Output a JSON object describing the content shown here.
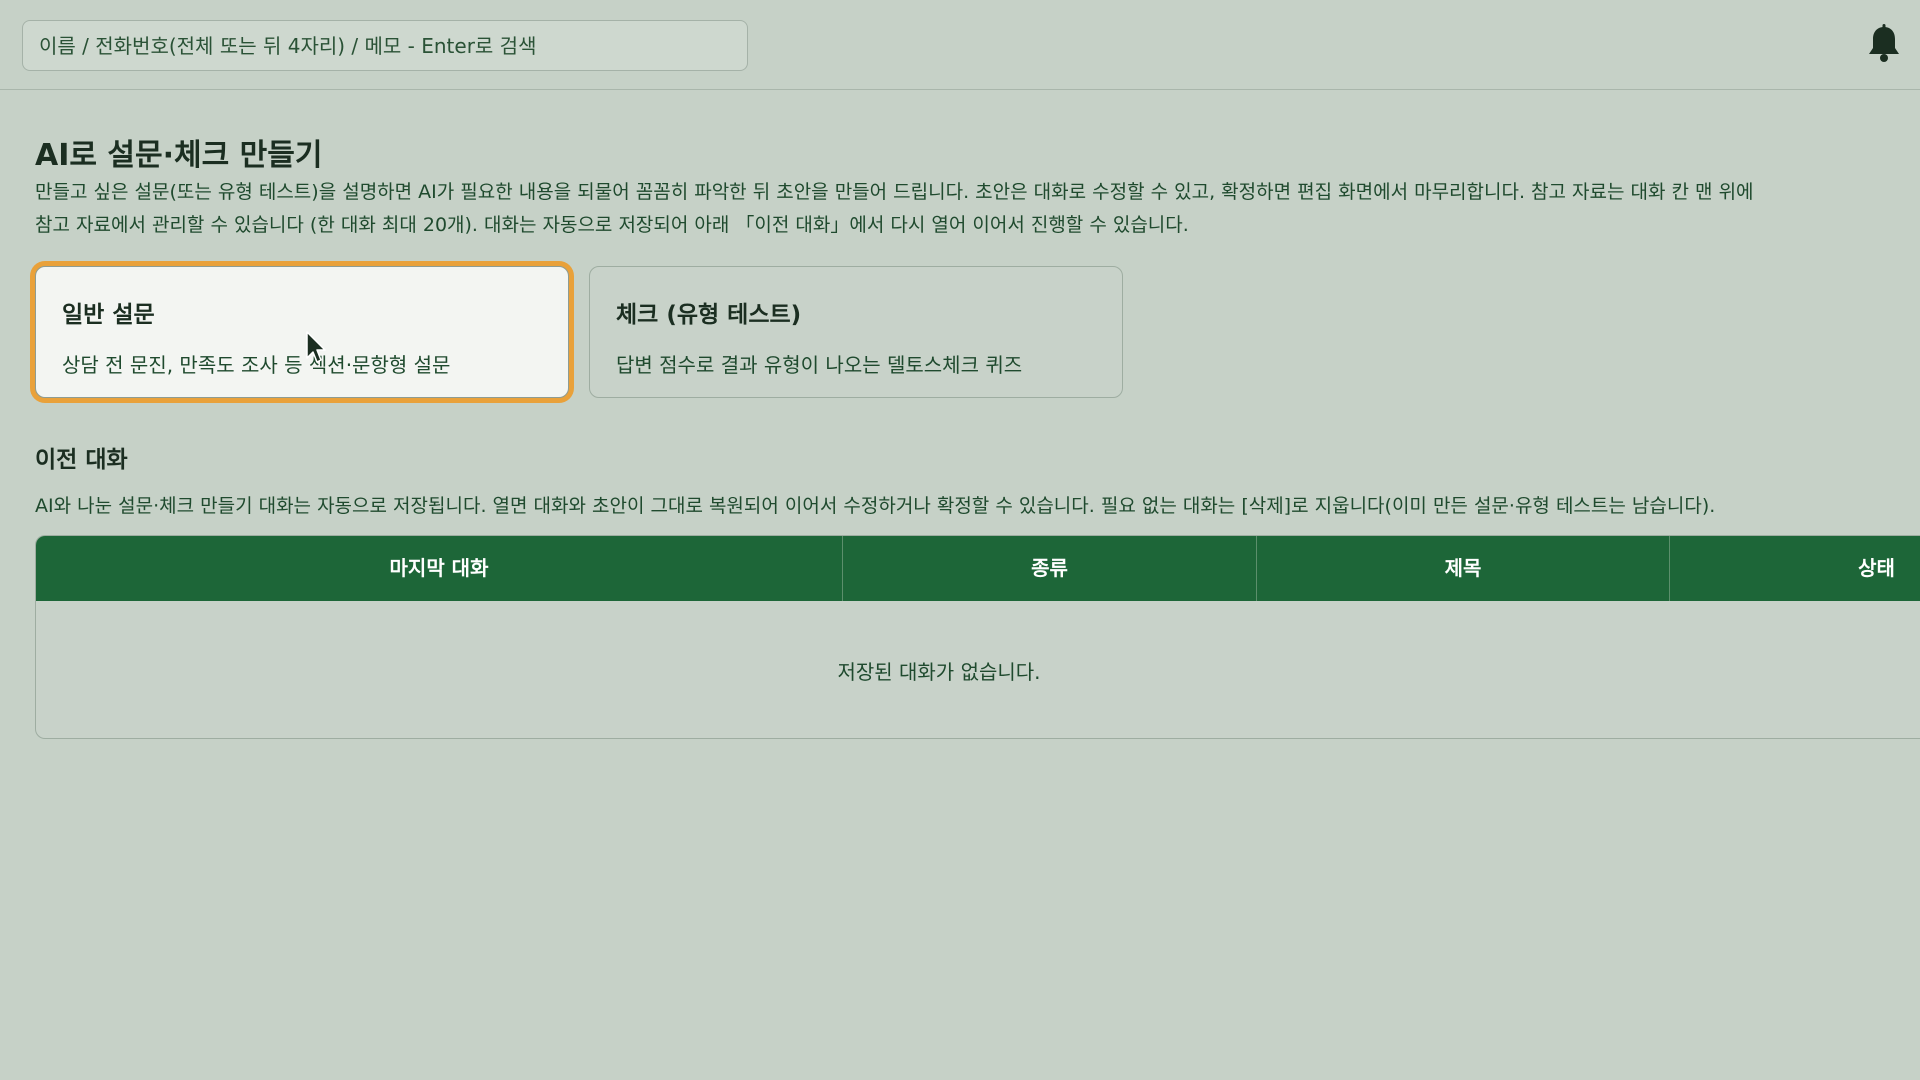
{
  "header": {
    "search_placeholder": "이름 / 전화번호(전체 또는 뒤 4자리) / 메모 - Enter로 검색",
    "bell_icon": "bell-icon"
  },
  "page": {
    "title": "AI로 설문·체크 만들기",
    "description_line1": "만들고 싶은 설문(또는 유형 테스트)을 설명하면 AI가 필요한 내용을 되물어 꼼꼼히 파악한 뒤 초안을 만들어 드립니다. 초안은 대화로 수정할 수 있고, 확정하면 편집 화면에서 마무리합니다. 참고 자료는 대화 칸 맨 위에",
    "description_line2": "참고 자료에서 관리할 수 있습니다 (한 대화 최대 20개). 대화는 자동으로 저장되어 아래 「이전 대화」에서 다시 열어 이어서 진행할 수 있습니다."
  },
  "cards": [
    {
      "title": "일반 설문",
      "subtitle": "상담 전 문진, 만족도 조사 등 섹션·문항형 설문",
      "selected": true
    },
    {
      "title": "체크 (유형 테스트)",
      "subtitle": "답변 점수로 결과 유형이 나오는 델토스체크 퀴즈",
      "selected": false
    }
  ],
  "history": {
    "title": "이전 대화",
    "description": "AI와 나눈 설문·체크 만들기 대화는 자동으로 저장됩니다. 열면 대화와 초안이 그대로 복원되어 이어서 수정하거나 확정할 수 있습니다. 필요 없는 대화는 [삭제]로 지웁니다(이미 만든 설문·유형 테스트는 남습니다).",
    "columns": [
      "마지막 대화",
      "종류",
      "제목",
      "상태"
    ],
    "empty_message": "저장된 대화가 없습니다."
  },
  "colors": {
    "background": "#c6d1c7",
    "table_header": "#1d6638",
    "selected_outline": "#e9a13a"
  }
}
